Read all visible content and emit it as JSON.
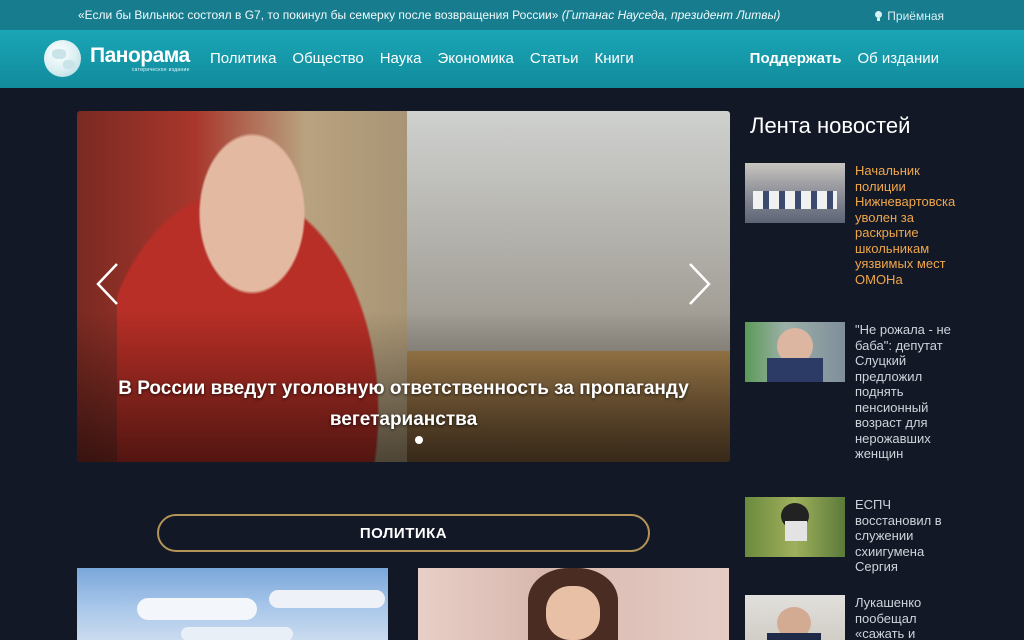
{
  "topbar": {
    "quote": "«Если бы Вильнюс состоял в G7, то покинул бы семерку после возвращения России»",
    "quote_author": "(Гитанас Науседа, президент Литвы)",
    "reception": "Приёмная"
  },
  "header": {
    "logo_name": "Панорама",
    "logo_sub": "сатирическое издание",
    "menu": [
      "Политика",
      "Общество",
      "Наука",
      "Экономика",
      "Статьи",
      "Книги"
    ],
    "support": "Поддержать",
    "about": "Об издании"
  },
  "slider": {
    "caption": "В России введут уголовную ответственность за пропаганду вегетарианства"
  },
  "section": {
    "label": "ПОЛИТИКА"
  },
  "feed": {
    "title": "Лента новостей",
    "items": [
      {
        "text": "Начальник полиции Нижневартовска уволен за раскрытие школьникам уязвимых мест ОМОНа",
        "highlight": true
      },
      {
        "text": "\"Не рожала - не баба\": депутат Слуцкий предложил поднять пенсионный возраст для нерожавших женщин",
        "highlight": false
      },
      {
        "text": "ЕСПЧ восстановил в служении схиигумена Сергия",
        "highlight": false
      },
      {
        "text": "Лукашенко пообещал «сажать и",
        "highlight": false
      }
    ]
  },
  "colors": {
    "topbar": "#177c8e",
    "navbar": "#1aa6b6",
    "background": "#121826",
    "accent_orange": "#f0a64a",
    "section_border": "#b39356"
  }
}
